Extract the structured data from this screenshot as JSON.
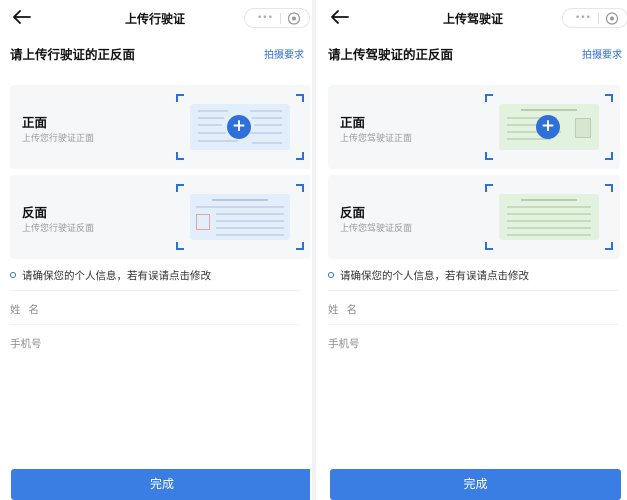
{
  "screens": [
    {
      "nav_title": "上传行驶证",
      "heading": "请上传行驶证的正反面",
      "link": "拍摄要求",
      "front": {
        "title": "正面",
        "subtitle": "上传您行驶证正面"
      },
      "back": {
        "title": "反面",
        "subtitle": "上传您行驶证反面"
      },
      "notice": "请确保您的个人信息，若有误请点击修改",
      "name_label": "姓名",
      "phone_label": "手机号",
      "button": "完成",
      "card_color": "blue"
    },
    {
      "nav_title": "上传驾驶证",
      "heading": "请上传驾驶证的正反面",
      "link": "拍摄要求",
      "front": {
        "title": "正面",
        "subtitle": "上传您驾驶证正面"
      },
      "back": {
        "title": "反面",
        "subtitle": "上传您驾驶证反面"
      },
      "notice": "请确保您的个人信息，若有误请点击修改",
      "name_label": "姓名",
      "phone_label": "手机号",
      "button": "完成",
      "card_color": "green"
    }
  ],
  "capsule": {
    "dots": "•••"
  },
  "icons": {
    "back": "arrow-left-icon",
    "eye": "eye-icon",
    "plus": "plus-icon"
  },
  "colors": {
    "accent": "#2f6fd8",
    "button": "#3b7ee3",
    "card_bg": "#f6f7f9"
  }
}
